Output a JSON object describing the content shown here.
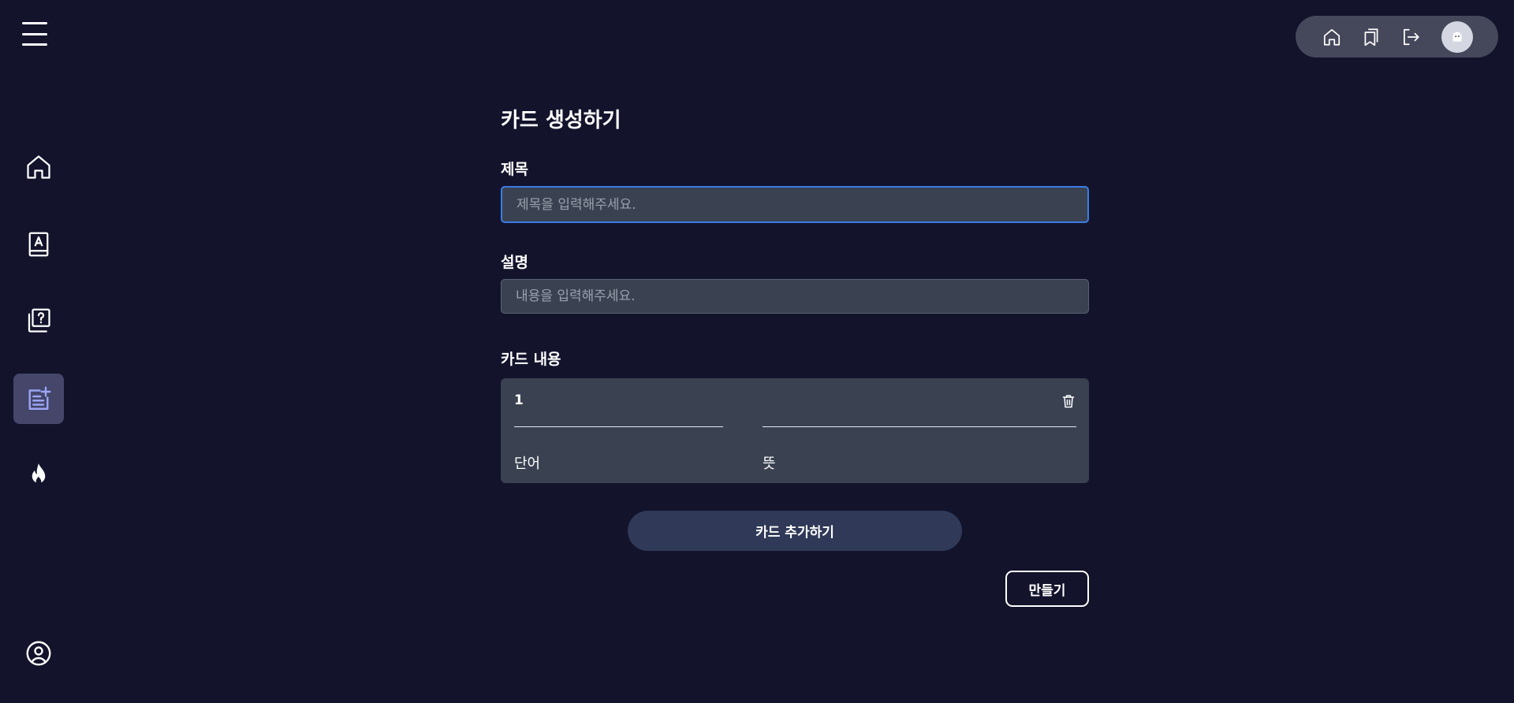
{
  "sidebar": {
    "items": [
      {
        "name": "home",
        "icon": "home-icon",
        "active": false
      },
      {
        "name": "wordbook",
        "icon": "book-letter-icon",
        "active": false
      },
      {
        "name": "quiz",
        "icon": "question-stack-icon",
        "active": false
      },
      {
        "name": "create-card",
        "icon": "note-add-icon",
        "active": true
      },
      {
        "name": "trending",
        "icon": "flame-icon",
        "active": false
      }
    ],
    "profile_icon": "user-circle-icon"
  },
  "topbar": {
    "icons": [
      "home-icon",
      "bookmark-icon",
      "logout-icon",
      "avatar"
    ]
  },
  "page": {
    "title": "카드 생성하기",
    "title_label": "제목",
    "title_placeholder": "제목을 입력해주세요.",
    "description_label": "설명",
    "description_placeholder": "내용을 입력해주세요.",
    "card_content_label": "카드 내용"
  },
  "cards": [
    {
      "number": "1",
      "word_label": "단어",
      "meaning_label": "뜻",
      "word": "",
      "meaning": ""
    }
  ],
  "buttons": {
    "add_card": "카드 추가하기",
    "create": "만들기"
  },
  "colors": {
    "background": "#13132c",
    "input_bg": "#3a4252",
    "focus": "#3b7ce6",
    "active_nav": "#45466a",
    "accent_icon": "#9aa6f5"
  }
}
